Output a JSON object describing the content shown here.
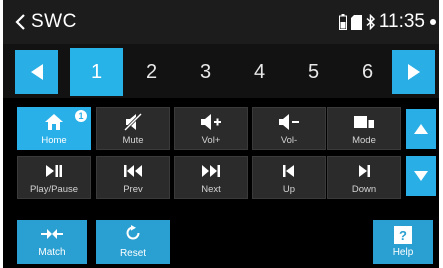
{
  "header": {
    "title": "SWC",
    "time": "11:35"
  },
  "pages": {
    "tabs": [
      "1",
      "2",
      "3",
      "4",
      "5",
      "6"
    ],
    "active": "1"
  },
  "keys": [
    {
      "label": "Home",
      "icon": "home-icon",
      "badge": "1"
    },
    {
      "label": "Mute",
      "icon": "mute-icon"
    },
    {
      "label": "Vol+",
      "icon": "volume-up-icon"
    },
    {
      "label": "Vol-",
      "icon": "volume-down-icon"
    },
    {
      "label": "Mode",
      "icon": "mode-icon"
    },
    {
      "label": "Play/Pause",
      "icon": "play-pause-icon"
    },
    {
      "label": "Prev",
      "icon": "previous-icon"
    },
    {
      "label": "Next",
      "icon": "next-icon"
    },
    {
      "label": "Up",
      "icon": "up-icon"
    },
    {
      "label": "Down",
      "icon": "down-icon"
    }
  ],
  "actions": {
    "match": "Match",
    "reset": "Reset",
    "help": "Help",
    "help_glyph": "?"
  },
  "colors": {
    "accent": "#29aee5",
    "key_bg": "#2b2b2b",
    "background": "#000000",
    "statusbar": "#1c1c1c"
  }
}
